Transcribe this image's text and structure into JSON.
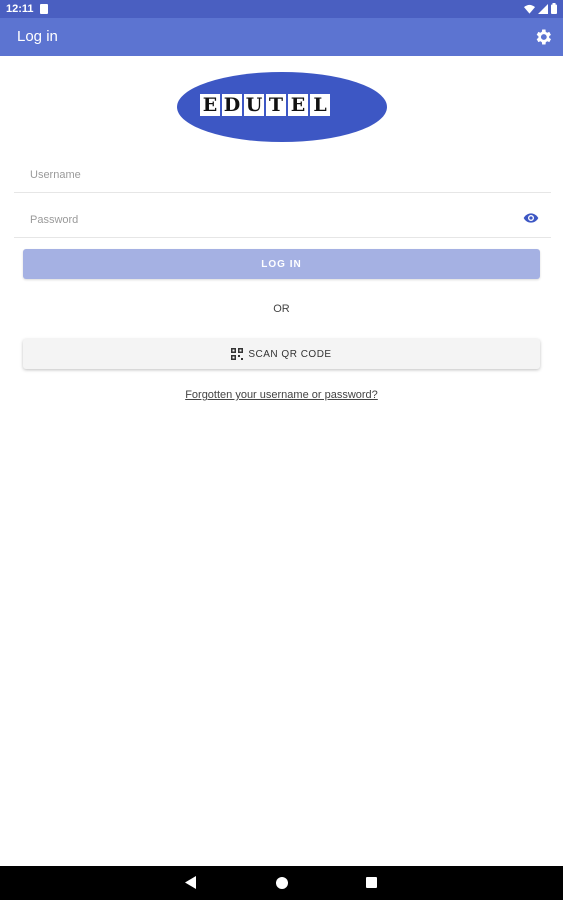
{
  "status_bar": {
    "time": "12:11",
    "icons": [
      "sd-card-icon",
      "wifi-icon",
      "signal-icon",
      "battery-icon"
    ]
  },
  "app_bar": {
    "title": "Log in",
    "settings_icon": "gear-icon"
  },
  "logo": {
    "letters": [
      "E",
      "D",
      "U",
      "T",
      "E",
      "L"
    ],
    "brand_color": "#3d57c4"
  },
  "form": {
    "username_placeholder": "Username",
    "username_value": "",
    "password_placeholder": "Password",
    "password_value": "",
    "password_toggle_icon": "eye-icon"
  },
  "buttons": {
    "login_label": "LOG IN",
    "or_label": "OR",
    "scan_label": "SCAN QR CODE",
    "scan_icon": "qr-code-icon"
  },
  "forgot_link": "Forgotten your username or password?",
  "colors": {
    "status_bar": "#4a5fc1",
    "app_bar": "#5c74d1",
    "login_button": "#a5b1e3",
    "eye_icon": "#3d57c4"
  },
  "nav_bar": {
    "icons": [
      "back-icon",
      "home-icon",
      "recents-icon"
    ]
  }
}
